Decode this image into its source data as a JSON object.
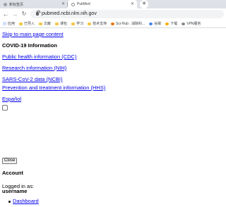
{
  "browser": {
    "tabs": [
      {
        "title": "新标签页",
        "active": false
      },
      {
        "title": "PubMed",
        "active": true
      }
    ],
    "new_tab_symbol": "+",
    "url": "pubmed.ncbi.nlm.nih.gov",
    "nav_icons": {
      "back": "←",
      "forward": "→",
      "reload": "↻"
    },
    "bookmarks": [
      {
        "label": "应用",
        "icon": "apps-icon"
      },
      {
        "label": "已导入",
        "icon": "folder-icon"
      },
      {
        "label": "文献",
        "icon": "folder-icon"
      },
      {
        "label": "课包",
        "icon": "folder-icon"
      },
      {
        "label": "学习",
        "icon": "folder-icon"
      },
      {
        "label": "技术支持",
        "icon": "folder-icon"
      },
      {
        "label": "Sci-Hub : 消除科...",
        "icon": "scihub-icon"
      },
      {
        "label": "谷歌",
        "icon": "globe-icon"
      },
      {
        "label": "下载",
        "icon": "q-icon"
      },
      {
        "label": "VPN服务",
        "icon": "vpn-icon"
      }
    ]
  },
  "page": {
    "skip_link": "Skip to main page content",
    "covid": {
      "heading": "COVID-19 Information",
      "links": [
        "Public health information (CDC)",
        "Research information (NIH)",
        "SARS-CoV-2 data (NCBI)",
        "Prevention and treatment information (HHS)",
        "Español"
      ]
    },
    "close_button": "Close",
    "account": {
      "heading": "Account",
      "logged_in_as": "Logged in as:",
      "username": "username",
      "menu": [
        "Dashboard"
      ]
    }
  },
  "colors": {
    "link": "#0000ee",
    "tabstrip": "#dee1e6",
    "omnibox": "#f1f3f4"
  }
}
